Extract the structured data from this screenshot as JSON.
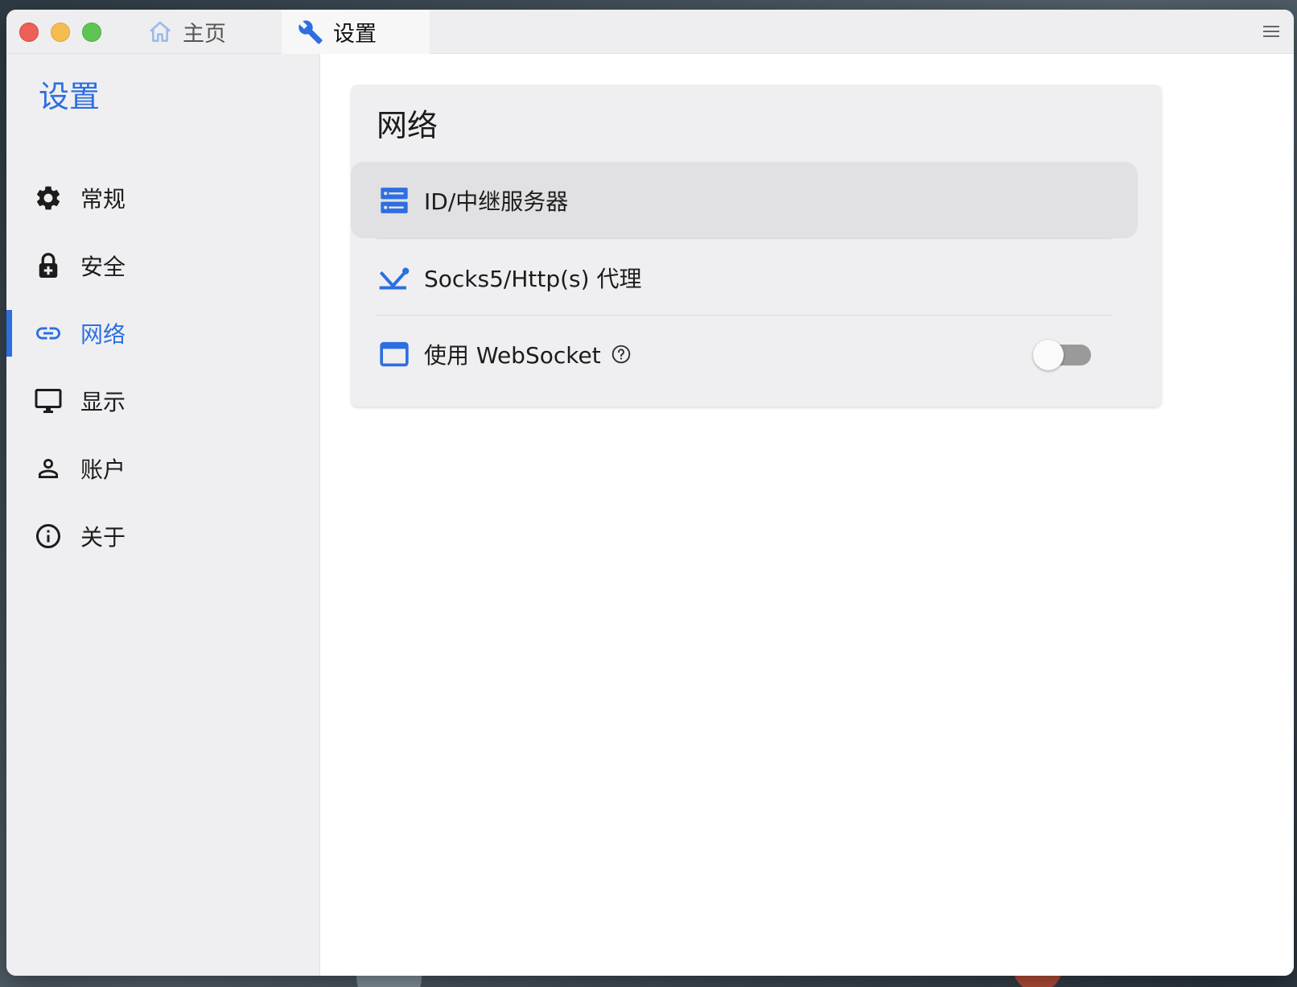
{
  "titlebar": {
    "tabs": [
      {
        "label": "主页",
        "icon": "home-icon"
      },
      {
        "label": "设置",
        "icon": "wrench-icon"
      }
    ]
  },
  "sidebar": {
    "title": "设置",
    "items": [
      {
        "label": "常规",
        "icon": "gear-icon"
      },
      {
        "label": "安全",
        "icon": "lock-icon"
      },
      {
        "label": "网络",
        "icon": "link-icon",
        "active": true
      },
      {
        "label": "显示",
        "icon": "monitor-icon"
      },
      {
        "label": "账户",
        "icon": "person-icon"
      },
      {
        "label": "关于",
        "icon": "info-icon"
      }
    ]
  },
  "network_card": {
    "title": "网络",
    "rows": [
      {
        "label": "ID/中继服务器",
        "icon": "server-icon"
      },
      {
        "label": "Socks5/Http(s) 代理",
        "icon": "proxy-icon"
      },
      {
        "label": "使用 WebSocket",
        "icon": "window-icon",
        "toggle_on": false
      }
    ]
  },
  "colors": {
    "accent": "#2d6fe0",
    "sidebar_bg": "#efeff1",
    "toggle_off": "#9a9a9a"
  }
}
